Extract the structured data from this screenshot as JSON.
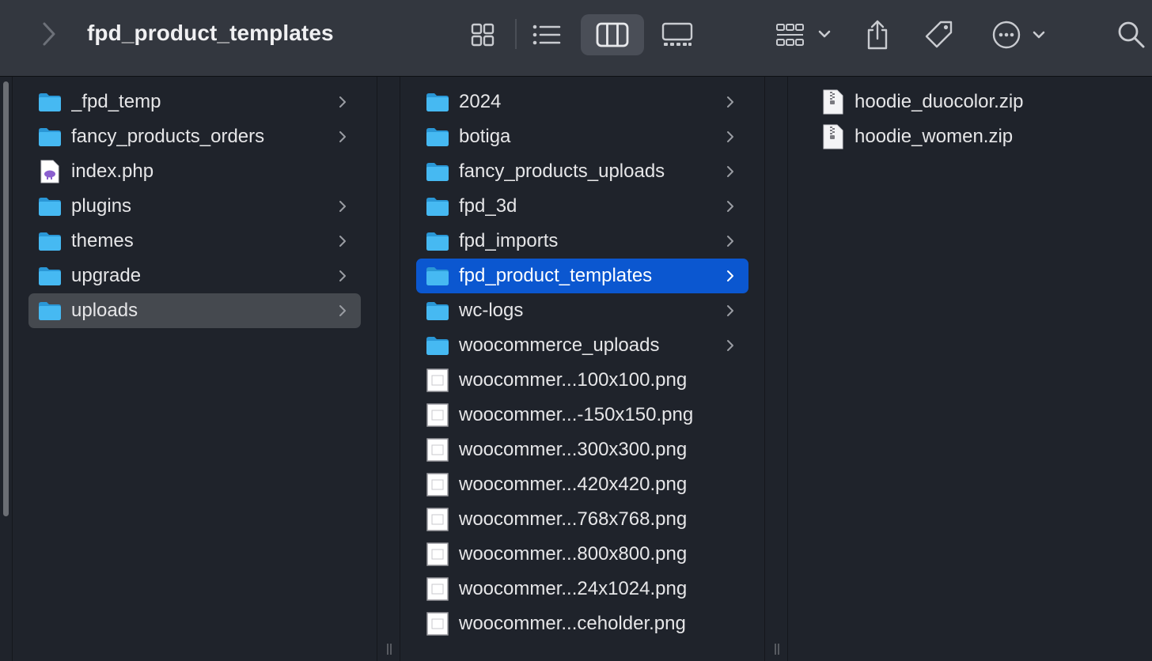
{
  "window": {
    "title": "fpd_product_templates"
  },
  "toolbar": {
    "icons": [
      "chevron-right-icon",
      "icon-view-icon",
      "list-view-icon",
      "column-view-icon",
      "gallery-view-icon",
      "group-icon",
      "share-icon",
      "tag-icon",
      "more-actions-icon",
      "search-icon"
    ],
    "active_view": "column-view"
  },
  "columns": [
    {
      "items": [
        {
          "label": "_fpd_temp",
          "type": "folder",
          "has_children": true
        },
        {
          "label": "fancy_products_orders",
          "type": "folder",
          "has_children": true
        },
        {
          "label": "index.php",
          "type": "php-file",
          "has_children": false
        },
        {
          "label": "plugins",
          "type": "folder",
          "has_children": true
        },
        {
          "label": "themes",
          "type": "folder",
          "has_children": true
        },
        {
          "label": "upgrade",
          "type": "folder",
          "has_children": true
        },
        {
          "label": "uploads",
          "type": "folder",
          "has_children": true,
          "selected": "inactive"
        }
      ]
    },
    {
      "items": [
        {
          "label": "2024",
          "type": "folder",
          "has_children": true
        },
        {
          "label": "botiga",
          "type": "folder",
          "has_children": true
        },
        {
          "label": "fancy_products_uploads",
          "type": "folder",
          "has_children": true
        },
        {
          "label": "fpd_3d",
          "type": "folder",
          "has_children": true
        },
        {
          "label": "fpd_imports",
          "type": "folder",
          "has_children": true
        },
        {
          "label": "fpd_product_templates",
          "type": "folder",
          "has_children": true,
          "selected": "active"
        },
        {
          "label": "wc-logs",
          "type": "folder",
          "has_children": true
        },
        {
          "label": "woocommerce_uploads",
          "type": "folder",
          "has_children": true
        },
        {
          "label": "woocommer...100x100.png",
          "type": "image-file",
          "has_children": false
        },
        {
          "label": "woocommer...-150x150.png",
          "type": "image-file",
          "has_children": false
        },
        {
          "label": "woocommer...300x300.png",
          "type": "image-file",
          "has_children": false
        },
        {
          "label": "woocommer...420x420.png",
          "type": "image-file",
          "has_children": false
        },
        {
          "label": "woocommer...768x768.png",
          "type": "image-file",
          "has_children": false
        },
        {
          "label": "woocommer...800x800.png",
          "type": "image-file",
          "has_children": false
        },
        {
          "label": "woocommer...24x1024.png",
          "type": "image-file",
          "has_children": false
        },
        {
          "label": "woocommer...ceholder.png",
          "type": "image-file",
          "has_children": false
        }
      ]
    },
    {
      "items": [
        {
          "label": "hoodie_duocolor.zip",
          "type": "zip-file",
          "has_children": false
        },
        {
          "label": "hoodie_women.zip",
          "type": "zip-file",
          "has_children": false
        }
      ]
    }
  ],
  "colors": {
    "toolbar_bg": "#33373f",
    "content_bg": "#1f232b",
    "selection_active": "#0b57d0",
    "selection_inactive": "#45494f",
    "folder_blue": "#3fb5f0"
  }
}
